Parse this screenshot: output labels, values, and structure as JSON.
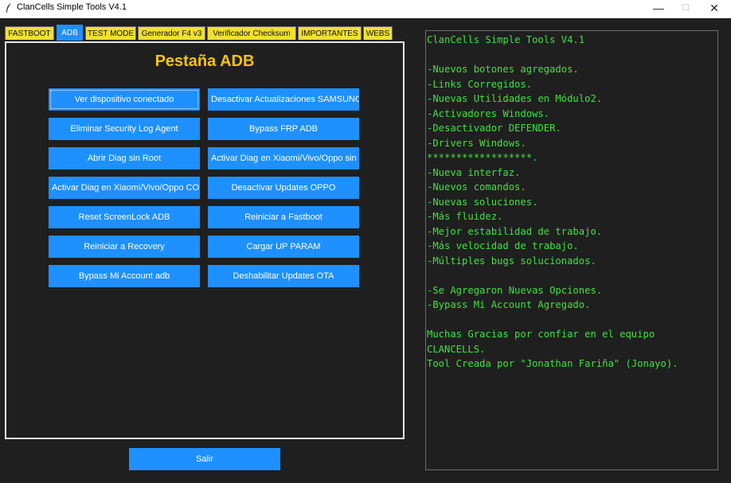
{
  "window": {
    "title": "ClanCells Simple Tools V4.1",
    "minimize_glyph": "—",
    "maximize_glyph": "☐",
    "close_glyph": "✕"
  },
  "tabs": [
    {
      "label": "FASTBOOT",
      "active": false
    },
    {
      "label": "ADB",
      "active": true
    },
    {
      "label": "TEST MODE",
      "active": false
    },
    {
      "label": "Generador F4 v3",
      "active": false
    },
    {
      "label": "Verificador Checksum",
      "active": false
    },
    {
      "label": "IMPORTANTES",
      "active": false
    },
    {
      "label": "WEBS",
      "active": false
    }
  ],
  "panel": {
    "title": "Pestaña ADB",
    "buttons_left": [
      "Ver dispositivo conectado",
      "Eliminar Security Log Agent",
      "Abrir Diag sin Root",
      "Activar Diag en Xiaomi/Vivo/Oppo CON ROOT",
      "Reset ScreenLock ADB",
      "Reiniciar a Recovery",
      "Bypass Mi Account adb"
    ],
    "buttons_right": [
      "Desactivar Actualizaciones SAMSUNG",
      "Bypass FRP ADB",
      "Activar Diag en Xiaomi/Vivo/Oppo sin root",
      "Desactivar Updates OPPO",
      "Reiniciar a Fastboot",
      "Cargar UP PARAM",
      "Deshabilitar Updates OTA"
    ]
  },
  "exit_button": "Salir",
  "changelog": [
    "ClanCells Simple Tools V4.1",
    "",
    "-Nuevos botones agregados.",
    "-Links Corregidos.",
    "-Nuevas Utilidades en Módulo2.",
    "-Activadores Windows.",
    "-Desactivador DEFENDER.",
    "-Drivers Windows.",
    "******************.",
    "-Nueva interfaz.",
    "-Nuevos comandos.",
    "-Nuevas soluciones.",
    "-Más fluidez.",
    "-Mejor estabilidad de trabajo.",
    "-Más velocidad de trabajo.",
    "-Múltiples bugs solucionados.",
    "",
    "-Se Agregaron Nuevas Opciones.",
    "-Bypass Mi Account Agregado.",
    "",
    "Muchas Gracias por confiar en el equipo",
    "CLANCELLS.",
    "Tool Creada por \"Jonathan Fariña\" (Jonayo)."
  ],
  "colors": {
    "background": "#1f1f1f",
    "accent_button": "#1e90ff",
    "tab_inactive": "#f0e030",
    "title_yellow": "#f2c40f",
    "log_text": "#3fe23f"
  }
}
